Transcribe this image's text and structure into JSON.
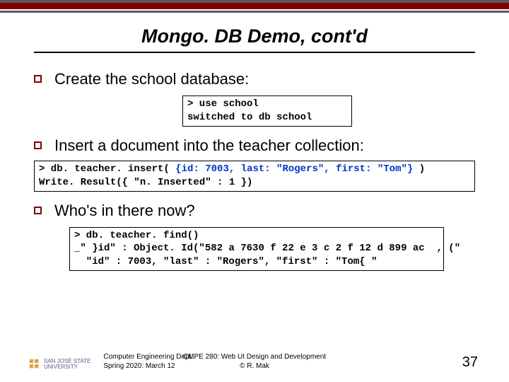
{
  "title": "Mongo. DB Demo, cont'd",
  "bullets": {
    "b1": "Create the school database:",
    "b2": "Insert a document into the teacher collection:",
    "b3": "Who's in there now?"
  },
  "code1": {
    "l1": "> use school",
    "l2": "switched to db school"
  },
  "code2": {
    "l1a": "> db. teacher. insert( ",
    "l1b": "{id: 7003, last: \"Rogers\", first: \"Tom\"}",
    "l1c": " )",
    "l2": "Write. Result({ \"n. Inserted\" : 1 })"
  },
  "code3": {
    "l1": "> db. teacher. find()",
    "l2": "_\" }id\" : Object. Id(\"582 a 7630 f 22 e 3 c 2 f 12 d 899 ac  , (\"",
    "l3": "  \"id\" : 7003, \"last\" : \"Rogers\", \"first\" : \"Tom{ \""
  },
  "footer": {
    "left1": "Computer Engineering Dept.",
    "left2": "Spring 2020: March 12",
    "center1": "CMPE 280: Web UI Design and Development",
    "center2": "© R. Mak",
    "page": "37",
    "logo1": "SAN JOSÉ STATE",
    "logo2": "UNIVERSITY"
  }
}
